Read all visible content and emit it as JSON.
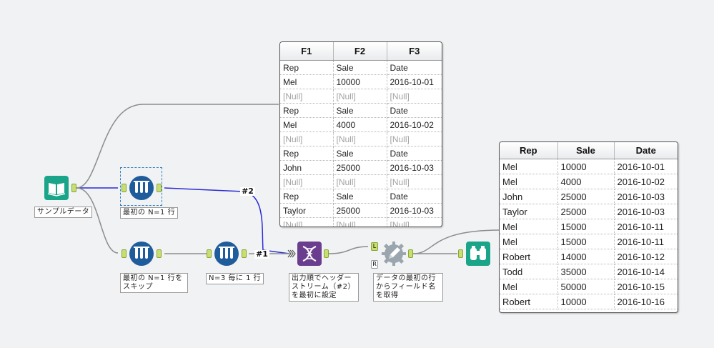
{
  "tools": {
    "sample_data": {
      "label": "サンプルデータ",
      "icon": "book-icon"
    },
    "first_n": {
      "label": "最初の N=1 行",
      "icon": "sample-tubes-icon"
    },
    "skip_first": {
      "label": "最初の N=1 行を\nスキップ",
      "icon": "sample-tubes-icon"
    },
    "every_nth": {
      "label": "N=3 毎に 1 行",
      "icon": "sample-tubes-icon"
    },
    "union": {
      "label": "出力順でヘッダー\nストリーム（#2）\nを最初に設定",
      "icon": "dna-icon"
    },
    "dynamic_rename": {
      "label": "データの最初の行\nからフィールド名\nを取得",
      "icon": "gear-pencil-icon",
      "anchor_left_top": "L",
      "anchor_left_bottom": "R"
    },
    "browse": {
      "icon": "binoculars-icon"
    }
  },
  "wire_labels": {
    "w1": "#2",
    "w2": "#1"
  },
  "grid1": {
    "headers": [
      "F1",
      "F2",
      "F3"
    ],
    "rows": [
      [
        "Rep",
        "Sale",
        "Date"
      ],
      [
        "Mel",
        "10000",
        "2016-10-01"
      ],
      [
        "[Null]",
        "[Null]",
        "[Null]"
      ],
      [
        "Rep",
        "Sale",
        "Date"
      ],
      [
        "Mel",
        "4000",
        "2016-10-02"
      ],
      [
        "[Null]",
        "[Null]",
        "[Null]"
      ],
      [
        "Rep",
        "Sale",
        "Date"
      ],
      [
        "John",
        "25000",
        "2016-10-03"
      ],
      [
        "[Null]",
        "[Null]",
        "[Null]"
      ],
      [
        "Rep",
        "Sale",
        "Date"
      ],
      [
        "Taylor",
        "25000",
        "2016-10-03"
      ],
      [
        "[Null]",
        "[Null]",
        "[Null]"
      ]
    ]
  },
  "grid2": {
    "headers": [
      "Rep",
      "Sale",
      "Date"
    ],
    "rows": [
      [
        "Mel",
        "10000",
        "2016-10-01"
      ],
      [
        "Mel",
        "4000",
        "2016-10-02"
      ],
      [
        "John",
        "25000",
        "2016-10-03"
      ],
      [
        "Taylor",
        "25000",
        "2016-10-03"
      ],
      [
        "Mel",
        "15000",
        "2016-10-11"
      ],
      [
        "Mel",
        "15000",
        "2016-10-11"
      ],
      [
        "Robert",
        "14000",
        "2016-10-12"
      ],
      [
        "Todd",
        "35000",
        "2016-10-14"
      ],
      [
        "Mel",
        "50000",
        "2016-10-15"
      ],
      [
        "Robert",
        "10000",
        "2016-10-16"
      ]
    ]
  },
  "colors": {
    "input_tool": "#1aa58a",
    "prep_tool": "#1f5c9b",
    "join_tool": "#6b3d8e",
    "developer_tool": "#9aa5ad",
    "output_tool": "#1aa58a",
    "anchor": "#c7df70",
    "wire_gray": "#8c8c8c",
    "wire_blue": "#2b2bd6"
  }
}
